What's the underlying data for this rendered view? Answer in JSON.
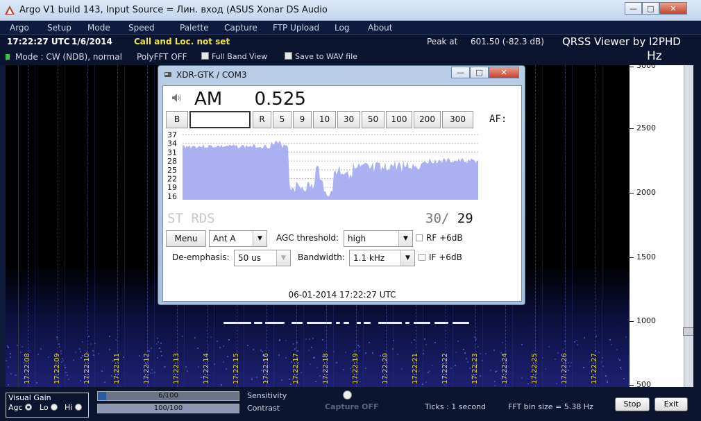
{
  "window": {
    "title": "Argo V1 build 143, Input Source = Лин. вход (ASUS Xonar DS Audio",
    "controls": [
      "—",
      "□",
      "✕"
    ]
  },
  "menu": [
    "Argo",
    "Setup",
    "Mode",
    "Speed",
    "Palette",
    "Capture",
    "FTP Upload",
    "Log",
    "About"
  ],
  "info": {
    "time": "17:22:27 UTC",
    "date": "1/6/2014",
    "call": "Call and Loc. not set",
    "peak_label": "Peak at",
    "peak_value": "601.50 (-82.3 dB)",
    "brand": "QRSS Viewer by I2PHD",
    "unit": "Hz"
  },
  "modebar": {
    "mode": "Mode : CW (NDB), normal",
    "polyfft": "PolyFFT OFF",
    "full_band": "Full Band View",
    "save_wav": "Save to WAV file"
  },
  "waterfall": {
    "time_ticks": [
      "17:22:08",
      "17:22:09",
      "17:22:10",
      "17:22:11",
      "17:22:12",
      "17:22:13",
      "17:22:14",
      "17:22:15",
      "17:22:16",
      "17:22:17",
      "17:22:18",
      "17:22:19",
      "17:22:20",
      "17:22:21",
      "17:22:22",
      "17:22:23",
      "17:22:24",
      "17:22:25",
      "17:22:26",
      "17:22:27"
    ],
    "freq_labels": [
      "3000",
      "2500",
      "2000",
      "1500",
      "1000",
      "500"
    ]
  },
  "bottom": {
    "vgain_title": "Visual Gain",
    "agc": "Agc",
    "lo": "Lo",
    "hi": "Hi",
    "sensitivity_value": "6/100",
    "sensitivity_fraction": 0.06,
    "contrast_value": "100/100",
    "contrast_fraction": 1.0,
    "sensitivity_label": "Sensitivity",
    "contrast_label": "Contrast",
    "capture": "Capture OFF",
    "ticks": "Ticks  : 1 second",
    "fft": "FFT bin size = 5.38 Hz",
    "stop": "Stop",
    "exit": "Exit"
  },
  "dialog": {
    "title": "XDR-GTK / COM3",
    "mode": "AM",
    "freq": "0.525",
    "buttons": [
      "B",
      "R",
      "5",
      "9",
      "10",
      "30",
      "50",
      "100",
      "200",
      "300"
    ],
    "freq_input": "",
    "af_label": "AF:",
    "spectrum_axis": [
      "37",
      "34",
      "31",
      "28",
      "25",
      "22",
      "19",
      "16"
    ],
    "st_rds": "ST RDS",
    "signal_a": "30/",
    "signal_b": "29",
    "menu_btn": "Menu",
    "antenna": "Ant A",
    "agc_label": "AGC threshold:",
    "agc_value": "high",
    "rf_label": "RF +6dB",
    "deemph_label": "De-emphasis:",
    "deemph_value": "50 us",
    "bw_label": "Bandwidth:",
    "bw_value": "1.1 kHz",
    "if_label": "IF +6dB",
    "timestamp": "06-01-2014 17:22:27 UTC"
  },
  "colors": {
    "call_yellow": "#f2e33a",
    "tick_yellow": "#e5d44a",
    "spectrum_fill": "#aab0f0"
  }
}
